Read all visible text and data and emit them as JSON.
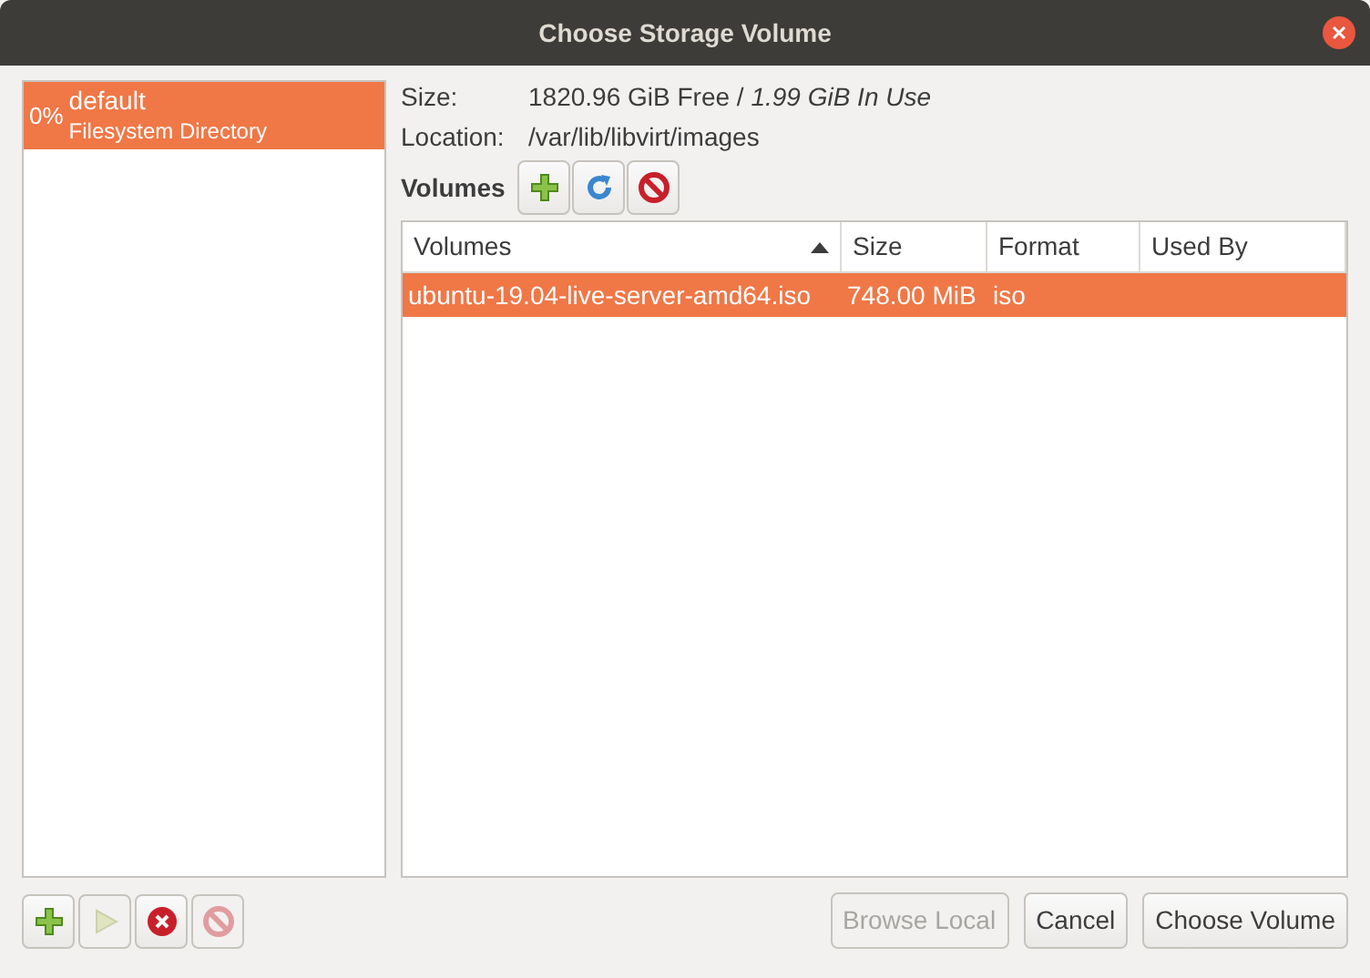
{
  "window": {
    "title": "Choose Storage Volume"
  },
  "pools": [
    {
      "usage": "0%",
      "name": "default",
      "type": "Filesystem Directory",
      "selected": true
    }
  ],
  "pool_buttons": [
    {
      "kind": "add",
      "disabled": false
    },
    {
      "kind": "start",
      "disabled": true
    },
    {
      "kind": "stop",
      "disabled": false
    },
    {
      "kind": "delete",
      "disabled": true
    }
  ],
  "details": {
    "size_label": "Size:",
    "size_value": "1820.96 GiB Free / *1.99 GiB In Use*",
    "location_label": "Location:",
    "location_value": "/var/lib/libvirt/images"
  },
  "volumes_label": "Volumes",
  "volume_buttons": [
    {
      "kind": "add",
      "disabled": false
    },
    {
      "kind": "refresh",
      "disabled": false
    },
    {
      "kind": "delete",
      "disabled": false
    }
  ],
  "table": {
    "columns": [
      {
        "label": "Volumes",
        "sorted": true
      },
      {
        "label": "Size",
        "sorted": false
      },
      {
        "label": "Format",
        "sorted": false
      },
      {
        "label": "Used By",
        "sorted": false
      }
    ],
    "rows": [
      {
        "cells": [
          "ubuntu-19.04-live-server-amd64.iso",
          "748.00 MiB",
          "iso",
          ""
        ],
        "selected": true
      }
    ]
  },
  "buttons": [
    {
      "label": "Browse Local",
      "disabled": true
    },
    {
      "label": "Cancel",
      "disabled": false
    },
    {
      "label": "Choose Volume",
      "disabled": false
    }
  ]
}
